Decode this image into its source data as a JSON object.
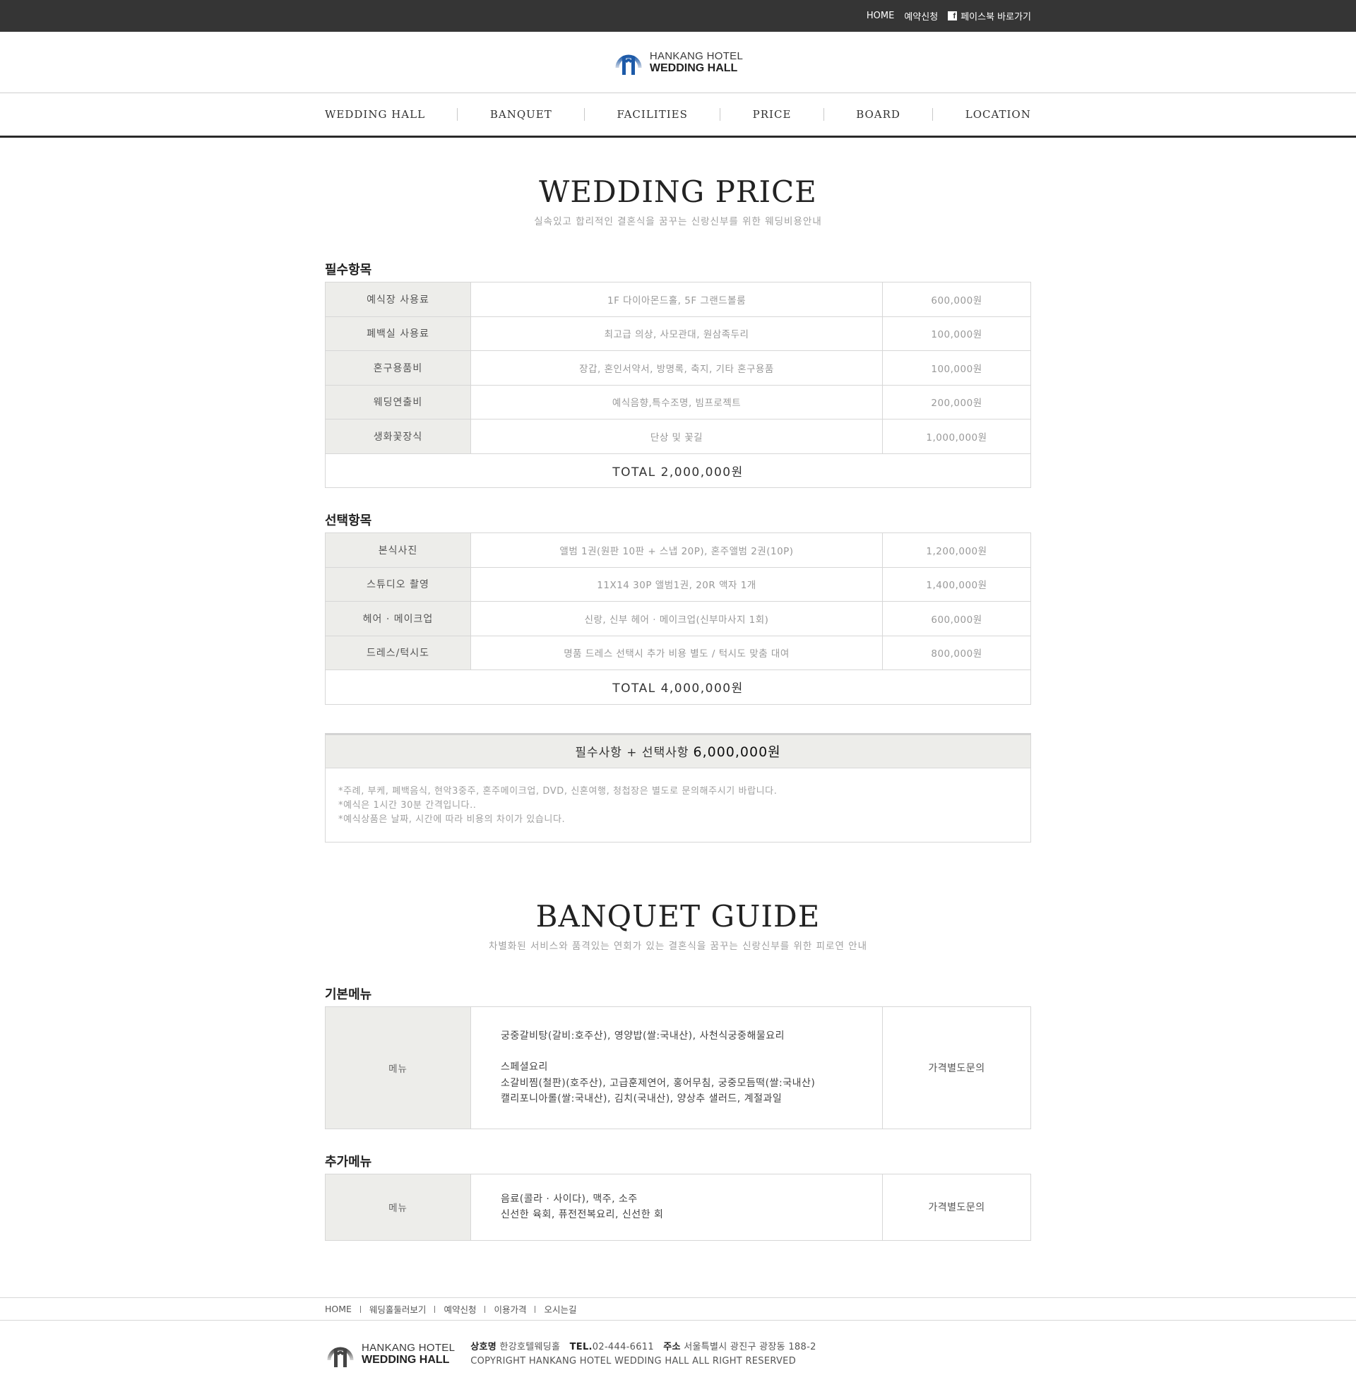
{
  "topbar": {
    "home": "HOME",
    "reservation": "예약신청",
    "facebook": "페이스북 바로가기"
  },
  "logo": {
    "line1": "HANKANG HOTEL",
    "line2": "WEDDING HALL"
  },
  "nav": [
    "WEDDING HALL",
    "BANQUET",
    "FACILITIES",
    "PRICE",
    "BOARD",
    "LOCATION"
  ],
  "wedding": {
    "title": "WEDDING PRICE",
    "subtitle": "실속있고 합리적인 결혼식을 꿈꾸는 신랑신부를 위한 웨딩비용안내",
    "required": {
      "title": "필수항목",
      "rows": [
        {
          "label": "예식장 사용료",
          "desc": "1F 다이아몬드홀, 5F 그랜드볼룸",
          "price": "600,000원"
        },
        {
          "label": "폐백실 사용료",
          "desc": "최고급 의상, 사모관대, 원삼족두리",
          "price": "100,000원"
        },
        {
          "label": "혼구용품비",
          "desc": "장갑, 혼인서약서, 방명록, 축지, 기타 혼구용품",
          "price": "100,000원"
        },
        {
          "label": "웨딩연출비",
          "desc": "예식음향,특수조명, 빔프로젝트",
          "price": "200,000원"
        },
        {
          "label": "생화꽃장식",
          "desc": "단상 및 꽃길",
          "price": "1,000,000원"
        }
      ],
      "total": "TOTAL 2,000,000원"
    },
    "optional": {
      "title": "선택항목",
      "rows": [
        {
          "label": "본식사진",
          "desc": "앨범 1권(원판 10판 + 스냅 20P), 혼주앨범 2권(10P)",
          "price": "1,200,000원"
        },
        {
          "label": "스튜디오 촬영",
          "desc": "11X14 30P 앨범1권, 20R 액자 1개",
          "price": "1,400,000원"
        },
        {
          "label": "헤어 · 메이크업",
          "desc": "신랑, 신부 헤어 · 메이크업(신부마사지 1회)",
          "price": "600,000원"
        },
        {
          "label": "드레스/턱시도",
          "desc": "명품 드레스 선택시 추가 비용 별도 / 턱시도 맞춤 대여",
          "price": "800,000원"
        }
      ],
      "total": "TOTAL 4,000,000원"
    },
    "summary": {
      "label": "필수사항 + 선택사항",
      "amount": "6,000,000원",
      "notes": [
        "*주례, 부케, 폐백음식, 현악3중주, 혼주메이크업, DVD, 신혼여행, 청첩장은 별도로 문의해주시기 바랍니다.",
        "*예식은 1시간 30분 간격입니다..",
        "*예식상품은 날짜, 시간에 따라 비용의 차이가 있습니다."
      ]
    }
  },
  "banquet": {
    "title": "BANQUET GUIDE",
    "subtitle": "차별화된 서비스와 품격있는 연회가 있는 결혼식을 꿈꾸는 신랑신부를 위한 피로연 안내",
    "basic": {
      "title": "기본메뉴",
      "label": "메뉴",
      "lines": [
        "궁중갈비탕(갈비:호주산), 영양밥(쌀:국내산), 사천식궁중해물요리",
        "",
        "스페셜요리",
        "소갈비찜(철판)(호주산), 고급훈제연어, 홍어무침, 궁중모듬떡(쌀:국내산)",
        "캘리포니아롤(쌀:국내산), 김치(국내산), 양상추 샐러드, 계절과일"
      ],
      "price": "가격별도문의"
    },
    "extra": {
      "title": "추가메뉴",
      "label": "메뉴",
      "lines": [
        "음료(콜라 · 사이다), 맥주, 소주",
        "신선한 육회, 퓨전전복요리, 신선한 회"
      ],
      "price": "가격별도문의"
    }
  },
  "footer": {
    "links": [
      "HOME",
      "웨딩홀둘러보기",
      "예약신청",
      "이용가격",
      "오시는길"
    ],
    "company_label": "상호명",
    "company": "한강호텔웨딩홀",
    "tel_label": "TEL.",
    "tel": "02-444-6611",
    "address_label": "주소",
    "address": "서울특별시 광진구 광장동 188-2",
    "copyright": "COPYRIGHT HANKANG HOTEL WEDDING HALL ALL RIGHT RESERVED"
  },
  "colors": {
    "topbar_bg": "#353535",
    "label_cell_bg": "#ededea",
    "border": "#d7d7d7",
    "logo_blue": "#1d5aa8"
  }
}
